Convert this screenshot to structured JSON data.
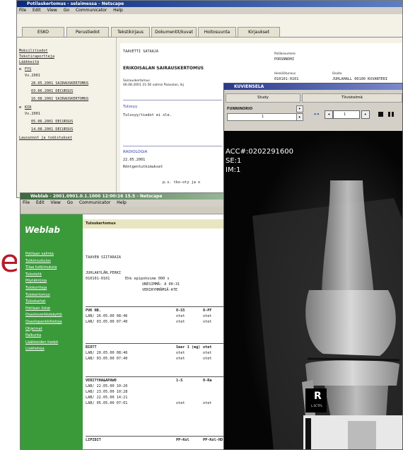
{
  "main_window": {
    "title": "Potilaskertomus - selaimessa - Netscape",
    "menu": [
      "File",
      "Edit",
      "View",
      "Go",
      "Communicator",
      "Help"
    ],
    "tabs": [
      "ESKO",
      "Perustiedot",
      "Tekstikirjaus",
      "Dokumentit/kuvat",
      "Hoitosuunta",
      "Kirjaukset"
    ],
    "sidebar": {
      "top_links": [
        "Mobiilitiedot",
        "Tekstiraportteja",
        "Lääkkeitä"
      ],
      "group1": {
        "label": "FYS",
        "sub": "Vv.2001",
        "items": [
          "28.05.2001 SAIRAUSKERTOMUS",
          "03.06.2001 DECURSUS",
          "16.08.2001 SAIRAUSKERTOMUS"
        ]
      },
      "group2": {
        "label": "KIR",
        "sub": "Vv.2001",
        "items": [
          "05.06.2001 DECURSUS",
          "14.08.2001 DECURSUS"
        ]
      },
      "footer_link": "Lausunnot ja todistukset"
    },
    "doc": {
      "patient": "TAAVETTI SATAAJA",
      "heading": "ERIKOISALAN SAIRAUSKERTOMUS",
      "meta_label": "Sairauskertomus",
      "meta_value": "06.08.2001 21:56 valmis Paavolan, lkj",
      "section_title": "Tulosyy",
      "section_text": "Tulosyy/tiedot ei ole.",
      "rad_title": "RADIOLOGIA",
      "rad_line1": "22.05.2001",
      "rad_line2": "Röntgentutkimukset",
      "rad_line3": "p.s. tko-oty ja o",
      "right_block": [
        {
          "label": "Potilasnumero",
          "value": "PORSNNOHI"
        },
        {
          "label": "Henkilötunnus",
          "value": "010101-0101"
        },
        {
          "label": "Osoite",
          "value": "JUHLAHALL 00100 KUVANTERI"
        }
      ]
    }
  },
  "weblab_window": {
    "title": "Weblab - 2001.0901.0.1.1000 12:00:16 15.5 - Netscape",
    "menu": [
      "File",
      "Edit",
      "View",
      "Go",
      "Communicator",
      "Help"
    ],
    "brand": "Weblab",
    "nav": [
      "Potilaan valinta",
      "Tutkimustulos",
      "Tilaa tutkimuksia",
      "Tulosleht",
      "Pöytäkirjoja",
      "Tulokortteja",
      "Tulokertomus",
      "Tuloskartat",
      "Potilaan listat",
      "Osastoverkkokäyttö",
      "Osastopankkitietoja",
      "Ohjelmat",
      "Palkunta",
      "Lääkkeiden tiedot",
      "Lisätietoja"
    ],
    "header": "Tuloskertomus",
    "patient": "TAAVEN SIITARAIA",
    "addr1": "JUHLAKYLÄN,PERKI",
    "addr2": "010101-0101",
    "addr2b": "Ehk epipohoime 000 s",
    "addr3": "UNESIMMÄ: A 00:31",
    "addr4": "VERIRYHMÄMSÄ-ATE",
    "tables": [
      {
        "name": "PVK NB.",
        "cols": [
          "0-S5",
          "0-PF"
        ],
        "rows": [
          [
            "LAB/ 26.05.00 08:46",
            "otet",
            "otet"
          ],
          [
            "LAB/ 03.05.00 07:40",
            "otet",
            "otet"
          ]
        ]
      },
      {
        "name": "BIOTT",
        "cols": [
          "Seer 1 (mg)",
          "otet"
        ],
        "rows": [
          [
            "LAB/ 20.05.00 08:46",
            "otet",
            "otet"
          ],
          [
            "LAB/ 03.05.00 07:40",
            "otet",
            "otet"
          ]
        ]
      },
      {
        "name": "VERITYHA&APAWO",
        "cols": [
          "1-S",
          "0-Ra"
        ],
        "rows": [
          [
            "LAB/ 22.05.00 10:20",
            "",
            ""
          ],
          [
            "LAB/ 23.05.00 10:28",
            "",
            ""
          ],
          [
            "LAB/ 22.05.00 14:21",
            "",
            ""
          ],
          [
            "LAB/ 05.05.00 07:01",
            "otet",
            "otet"
          ]
        ]
      },
      {
        "name": "LIPIDIT",
        "cols": [
          "PP-Kol",
          "PP-Kol-HD"
        ],
        "rows": []
      }
    ],
    "watermark_letter": "e"
  },
  "xray_window": {
    "title": "KUVIENSELA",
    "tabs": [
      "Study",
      "Tiivistelmä"
    ],
    "field_label": "FUNNINORIO",
    "page_label": "1",
    "series_label": "1",
    "overlay": {
      "acc": "ACC#:0202291600",
      "se": "SE:1",
      "im": "IM:1"
    },
    "marker": "R",
    "marker_sub": "L.SCTPL"
  }
}
